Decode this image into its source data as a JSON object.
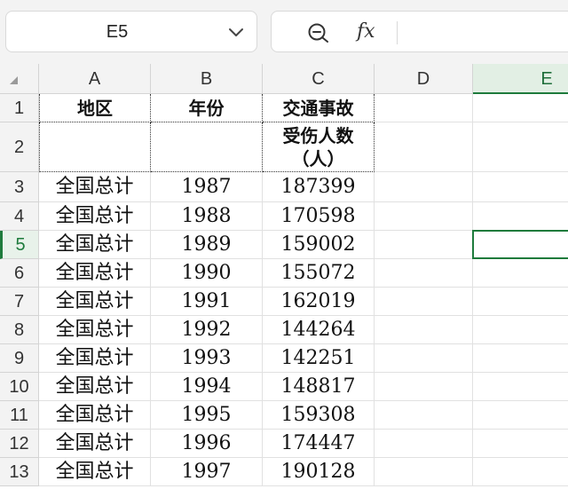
{
  "name_box": {
    "cell_ref": "E5"
  },
  "formula_bar": {
    "fx_label": "fx"
  },
  "columns": [
    "A",
    "B",
    "C",
    "D",
    "E"
  ],
  "rows": [
    "1",
    "2",
    "3",
    "4",
    "5",
    "6",
    "7",
    "8",
    "9",
    "10",
    "11",
    "12",
    "13"
  ],
  "selected": {
    "column": "E",
    "row": "5"
  },
  "table": {
    "headers": {
      "region": "地区",
      "year": "年份",
      "injured_line1": "交通事故",
      "injured_line2": "受伤人数",
      "injured_line3": "（人）"
    },
    "data_rows": [
      {
        "region": "全国总计",
        "year": "1987",
        "injured": "187399"
      },
      {
        "region": "全国总计",
        "year": "1988",
        "injured": "170598"
      },
      {
        "region": "全国总计",
        "year": "1989",
        "injured": "159002"
      },
      {
        "region": "全国总计",
        "year": "1990",
        "injured": "155072"
      },
      {
        "region": "全国总计",
        "year": "1991",
        "injured": "162019"
      },
      {
        "region": "全国总计",
        "year": "1992",
        "injured": "144264"
      },
      {
        "region": "全国总计",
        "year": "1993",
        "injured": "142251"
      },
      {
        "region": "全国总计",
        "year": "1994",
        "injured": "148817"
      },
      {
        "region": "全国总计",
        "year": "1995",
        "injured": "159308"
      },
      {
        "region": "全国总计",
        "year": "1996",
        "injured": "174447"
      },
      {
        "region": "全国总计",
        "year": "1997",
        "injured": "190128"
      }
    ]
  },
  "colors": {
    "accent": "#1e7b3c",
    "selected_header_bg": "#e2efe4"
  }
}
